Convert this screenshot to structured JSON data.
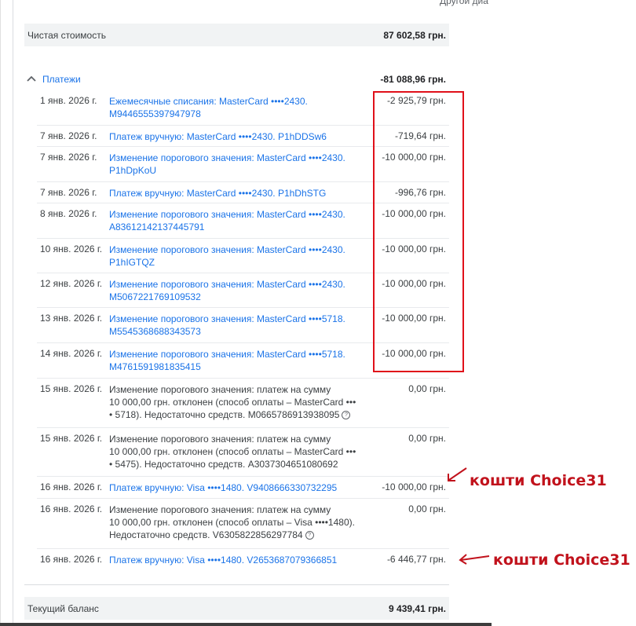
{
  "header": {
    "right_text": "Другой диа"
  },
  "net_value": {
    "label": "Чистая стоимость",
    "value": "87 602,58 грн."
  },
  "payments": {
    "title": "Платежи",
    "total": "-81 088,96 грн.",
    "rows": [
      {
        "date": "1 янв. 2026 г.",
        "desc": "Ежемесячные списания: MasterCard  ••••2430.\nM9446555397947978",
        "amount": "-2 925,79 грн."
      },
      {
        "date": "7 янв. 2026 г.",
        "desc": "Платеж вручную: MasterCard  ••••2430. P1hDDSw6",
        "amount": "-719,64 грн."
      },
      {
        "date": "7 янв. 2026 г.",
        "desc": "Изменение порогового значения: MasterCard  ••••2430.\nP1hDpKoU",
        "amount": "-10 000,00 грн."
      },
      {
        "date": "7 янв. 2026 г.",
        "desc": "Платеж вручную: MasterCard  ••••2430. P1hDhSTG",
        "amount": "-996,76 грн."
      },
      {
        "date": "8 янв. 2026 г.",
        "desc": "Изменение порогового значения: MasterCard  ••••2430.\nA83612142137445791",
        "amount": "-10 000,00 грн."
      },
      {
        "date": "10 янв. 2026 г.",
        "desc": "Изменение порогового значения: MasterCard  ••••2430.\nP1hIGTQZ",
        "amount": "-10 000,00 грн."
      },
      {
        "date": "12 янв. 2026 г.",
        "desc": "Изменение порогового значения: MasterCard  ••••2430.\nM5067221769109532",
        "amount": "-10 000,00 грн."
      },
      {
        "date": "13 янв. 2026 г.",
        "desc": "Изменение порогового значения: MasterCard  ••••5718.\nM5545368688343573",
        "amount": "-10 000,00 грн."
      },
      {
        "date": "14 янв. 2026 г.",
        "desc": "Изменение порогового значения: MasterCard  ••••5718.\nM4761591981835415",
        "amount": "-10 000,00 грн."
      },
      {
        "date": "15 янв. 2026 г.",
        "desc": "Изменение порогового значения: платеж на сумму\n10 000,00 грн. отклонен (способ оплаты – MasterCard •••\n• 5718). Недостаточно средств. M0665786913938095",
        "amount": "0,00 грн."
      },
      {
        "date": "15 янв. 2026 г.",
        "desc": "Изменение порогового значения: платеж на сумму\n10 000,00 грн. отклонен (способ оплаты – MasterCard •••\n• 5475). Недостаточно средств. A3037304651080692",
        "amount": "0,00 грн."
      },
      {
        "date": "16 янв. 2026 г.",
        "desc": "Платеж вручную: Visa  ••••1480. V9408666330732295",
        "amount": "-10 000,00 грн."
      },
      {
        "date": "16 янв. 2026 г.",
        "desc": "Изменение порогового значения: платеж на сумму\n10 000,00 грн. отклонен (способ оплаты – Visa  ••••1480).\nНедостаточно средств. V6305822856297784",
        "amount": "0,00 грн."
      },
      {
        "date": "16 янв. 2026 г.",
        "desc": "Платеж вручную: Visa  ••••1480. V2653687079366851",
        "amount": "-6 446,77 грн."
      }
    ]
  },
  "balance": {
    "label": "Текущий баланс",
    "value": "9 439,41 грн."
  },
  "annotations": {
    "note1": "кошти Choice31",
    "note2": "кошти Choice31"
  },
  "colors": {
    "link": "#1a73e8",
    "annotation": "#c1121c",
    "summary_bg": "#f1f3f4"
  },
  "icons": {
    "collapse": "chevron-up-icon",
    "help": "help-circle-icon",
    "annotation_arrow": "arrow-icon"
  }
}
